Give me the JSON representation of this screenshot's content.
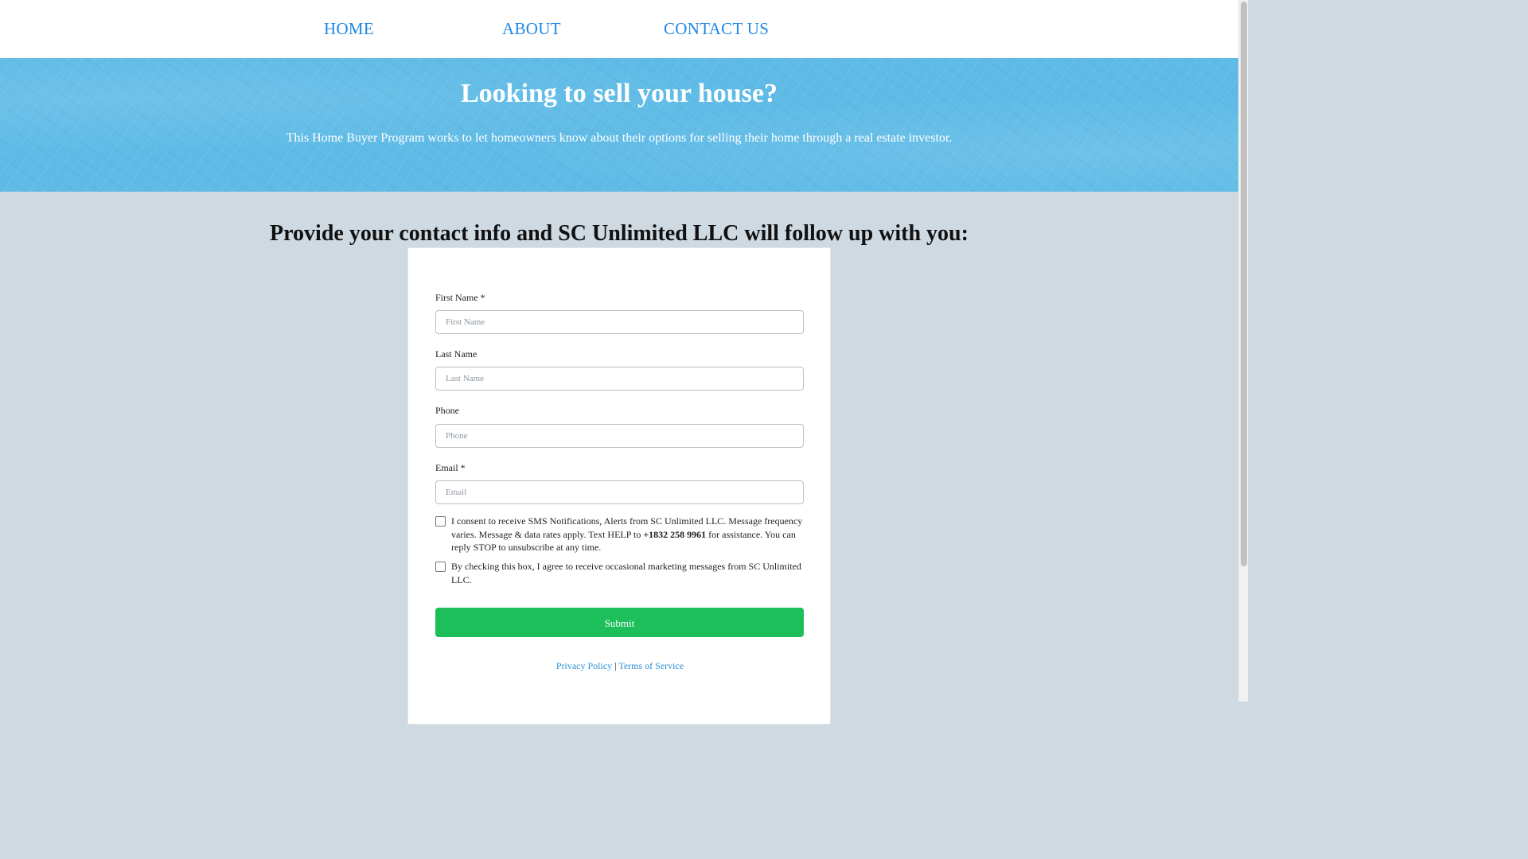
{
  "nav": {
    "home": "HOME",
    "about": "ABOUT",
    "contact": "CONTACT US"
  },
  "hero": {
    "title": "Looking to sell your house?",
    "subtitle": "This Home Buyer Program works to let homeowners know about their options for selling their home through a real estate investor."
  },
  "section": {
    "title": "Provide your contact info and SC Unlimited LLC will follow up with you:"
  },
  "form": {
    "first_name": {
      "label": "First Name *",
      "placeholder": "First Name"
    },
    "last_name": {
      "label": "Last Name",
      "placeholder": "Last Name"
    },
    "phone": {
      "label": "Phone",
      "placeholder": "Phone"
    },
    "email": {
      "label": "Email *",
      "placeholder": "Email"
    },
    "sms_consent": {
      "text_before": "I consent to receive SMS Notifications, Alerts from SC Unlimited LLC. Message frequency varies. Message & data rates apply. Text HELP to ",
      "phone": "+1832 258 9961",
      "text_after": " for assistance. You can reply STOP to unsubscribe at any time."
    },
    "marketing_consent": {
      "text": "By checking this box, I agree to receive occasional marketing messages from SC Unlimited LLC."
    },
    "submit_label": "Submit"
  },
  "footer": {
    "privacy": "Privacy Policy",
    "separator": " | ",
    "terms": "Terms of Service"
  },
  "colors": {
    "nav_link": "#1e88e5",
    "hero_bg": "#5fbbe6",
    "page_bg": "#ced9e2",
    "submit_bg": "#1dbf5a",
    "footer_link": "#2c8fd6"
  }
}
